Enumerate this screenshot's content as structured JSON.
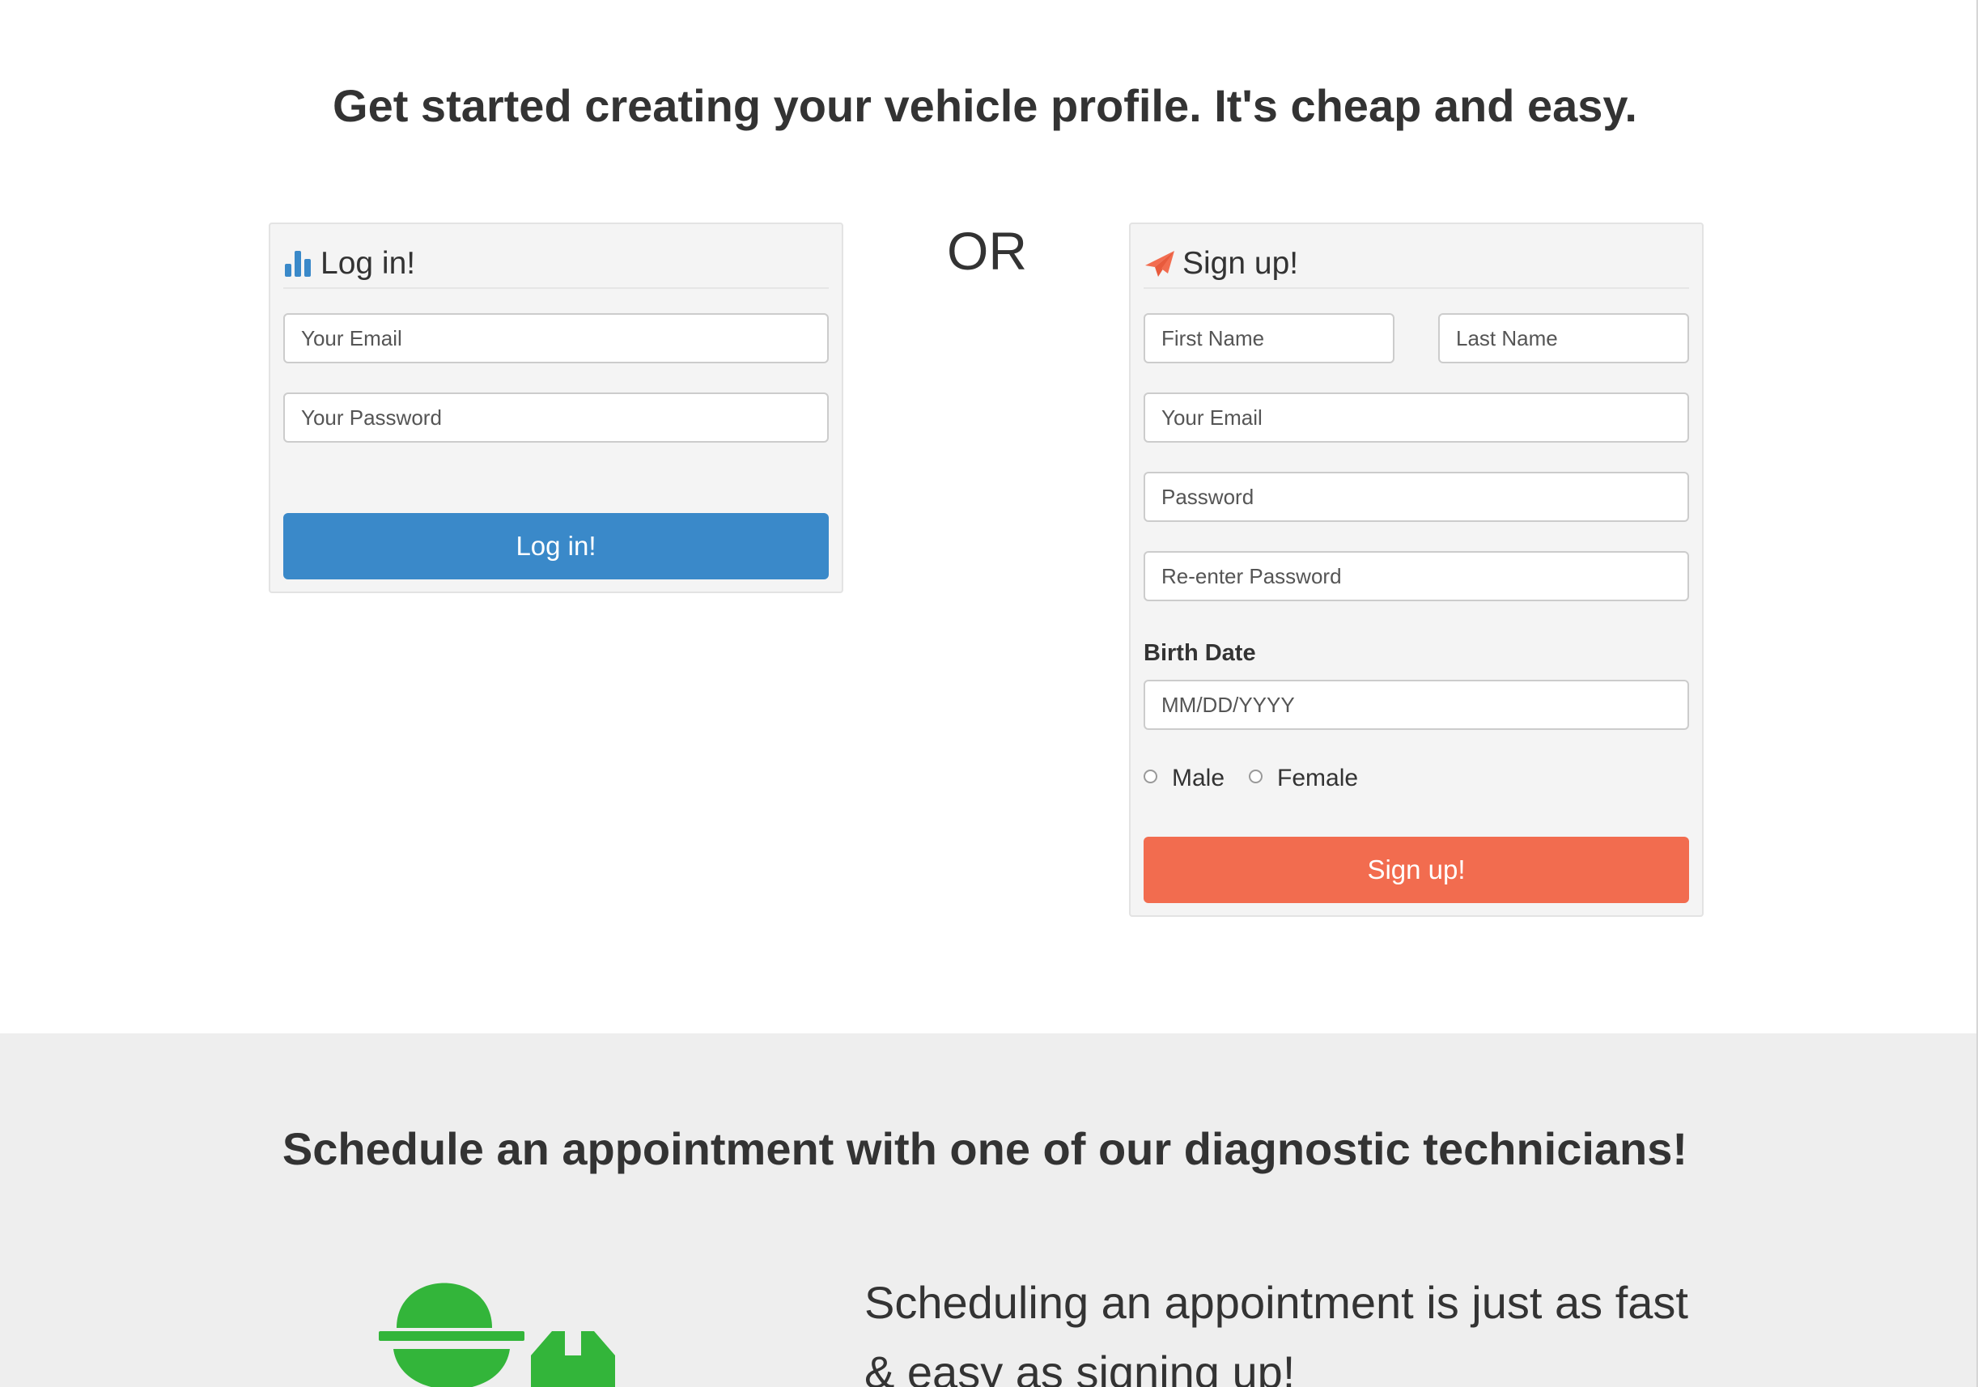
{
  "headline": "Get started creating your vehicle profile. It's cheap and easy.",
  "or_label": "OR",
  "login": {
    "title": "Log in!",
    "email_placeholder": "Your Email",
    "password_placeholder": "Your Password",
    "button_label": "Log in!"
  },
  "signup": {
    "title": "Sign up!",
    "first_name_placeholder": "First Name",
    "last_name_placeholder": "Last Name",
    "email_placeholder": "Your Email",
    "password_placeholder": "Password",
    "reenter_password_placeholder": "Re-enter Password",
    "birth_date_label": "Birth Date",
    "birth_date_placeholder": "MM/DD/YYYY",
    "gender_options": [
      "Male",
      "Female"
    ],
    "button_label": "Sign up!"
  },
  "appointment": {
    "heading": "Schedule an appointment with one of our diagnostic technicians!",
    "description": "Scheduling an appointment is just as fast & easy as signing up!"
  },
  "icons": {
    "login_icon": "bar-chart-icon",
    "signup_icon": "paper-plane-icon",
    "illustration": "technician-wrench-icon"
  },
  "colors": {
    "login_accent": "#3a89c9",
    "signup_accent": "#f26c4f",
    "illustration_green": "#33b53a"
  }
}
